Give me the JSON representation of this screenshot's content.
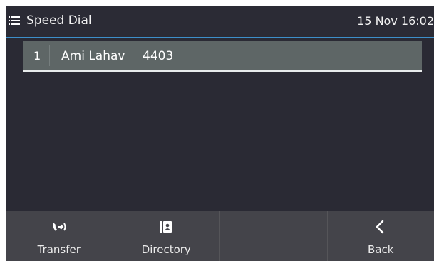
{
  "header": {
    "title": "Speed Dial",
    "clock": "15 Nov 16:02",
    "menu_icon": "list-menu-icon"
  },
  "speed_dial": {
    "entries": [
      {
        "index": "1",
        "name": "Ami Lahav",
        "number": "4403"
      }
    ]
  },
  "softkeys": [
    {
      "label": "Transfer",
      "icon": "transfer-call-icon"
    },
    {
      "label": "Directory",
      "icon": "contact-book-icon"
    },
    {
      "label": "",
      "icon": ""
    },
    {
      "label": "Back",
      "icon": "chevron-left-icon"
    }
  ],
  "colors": {
    "background": "#2a2a34",
    "header_accent": "#3d8fc9",
    "selected_row": "#5e6666",
    "softkey_bar": "#44444a"
  }
}
